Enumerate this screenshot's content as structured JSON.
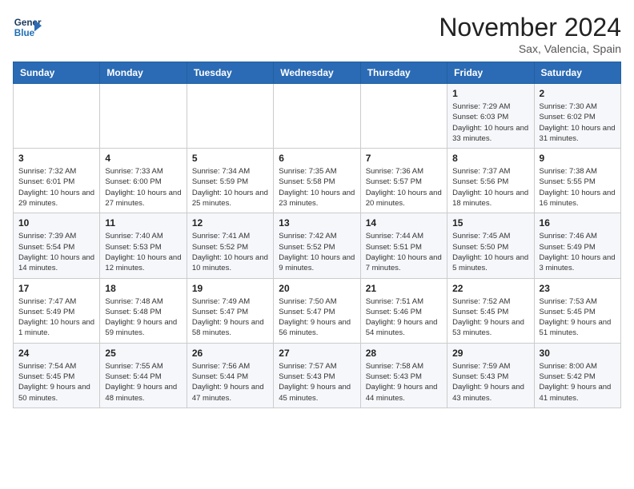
{
  "header": {
    "logo_line1": "General",
    "logo_line2": "Blue",
    "month": "November 2024",
    "location": "Sax, Valencia, Spain"
  },
  "weekdays": [
    "Sunday",
    "Monday",
    "Tuesday",
    "Wednesday",
    "Thursday",
    "Friday",
    "Saturday"
  ],
  "weeks": [
    [
      {
        "day": "",
        "info": ""
      },
      {
        "day": "",
        "info": ""
      },
      {
        "day": "",
        "info": ""
      },
      {
        "day": "",
        "info": ""
      },
      {
        "day": "",
        "info": ""
      },
      {
        "day": "1",
        "info": "Sunrise: 7:29 AM\nSunset: 6:03 PM\nDaylight: 10 hours\nand 33 minutes."
      },
      {
        "day": "2",
        "info": "Sunrise: 7:30 AM\nSunset: 6:02 PM\nDaylight: 10 hours\nand 31 minutes."
      }
    ],
    [
      {
        "day": "3",
        "info": "Sunrise: 7:32 AM\nSunset: 6:01 PM\nDaylight: 10 hours\nand 29 minutes."
      },
      {
        "day": "4",
        "info": "Sunrise: 7:33 AM\nSunset: 6:00 PM\nDaylight: 10 hours\nand 27 minutes."
      },
      {
        "day": "5",
        "info": "Sunrise: 7:34 AM\nSunset: 5:59 PM\nDaylight: 10 hours\nand 25 minutes."
      },
      {
        "day": "6",
        "info": "Sunrise: 7:35 AM\nSunset: 5:58 PM\nDaylight: 10 hours\nand 23 minutes."
      },
      {
        "day": "7",
        "info": "Sunrise: 7:36 AM\nSunset: 5:57 PM\nDaylight: 10 hours\nand 20 minutes."
      },
      {
        "day": "8",
        "info": "Sunrise: 7:37 AM\nSunset: 5:56 PM\nDaylight: 10 hours\nand 18 minutes."
      },
      {
        "day": "9",
        "info": "Sunrise: 7:38 AM\nSunset: 5:55 PM\nDaylight: 10 hours\nand 16 minutes."
      }
    ],
    [
      {
        "day": "10",
        "info": "Sunrise: 7:39 AM\nSunset: 5:54 PM\nDaylight: 10 hours\nand 14 minutes."
      },
      {
        "day": "11",
        "info": "Sunrise: 7:40 AM\nSunset: 5:53 PM\nDaylight: 10 hours\nand 12 minutes."
      },
      {
        "day": "12",
        "info": "Sunrise: 7:41 AM\nSunset: 5:52 PM\nDaylight: 10 hours\nand 10 minutes."
      },
      {
        "day": "13",
        "info": "Sunrise: 7:42 AM\nSunset: 5:52 PM\nDaylight: 10 hours\nand 9 minutes."
      },
      {
        "day": "14",
        "info": "Sunrise: 7:44 AM\nSunset: 5:51 PM\nDaylight: 10 hours\nand 7 minutes."
      },
      {
        "day": "15",
        "info": "Sunrise: 7:45 AM\nSunset: 5:50 PM\nDaylight: 10 hours\nand 5 minutes."
      },
      {
        "day": "16",
        "info": "Sunrise: 7:46 AM\nSunset: 5:49 PM\nDaylight: 10 hours\nand 3 minutes."
      }
    ],
    [
      {
        "day": "17",
        "info": "Sunrise: 7:47 AM\nSunset: 5:49 PM\nDaylight: 10 hours\nand 1 minute."
      },
      {
        "day": "18",
        "info": "Sunrise: 7:48 AM\nSunset: 5:48 PM\nDaylight: 9 hours\nand 59 minutes."
      },
      {
        "day": "19",
        "info": "Sunrise: 7:49 AM\nSunset: 5:47 PM\nDaylight: 9 hours\nand 58 minutes."
      },
      {
        "day": "20",
        "info": "Sunrise: 7:50 AM\nSunset: 5:47 PM\nDaylight: 9 hours\nand 56 minutes."
      },
      {
        "day": "21",
        "info": "Sunrise: 7:51 AM\nSunset: 5:46 PM\nDaylight: 9 hours\nand 54 minutes."
      },
      {
        "day": "22",
        "info": "Sunrise: 7:52 AM\nSunset: 5:45 PM\nDaylight: 9 hours\nand 53 minutes."
      },
      {
        "day": "23",
        "info": "Sunrise: 7:53 AM\nSunset: 5:45 PM\nDaylight: 9 hours\nand 51 minutes."
      }
    ],
    [
      {
        "day": "24",
        "info": "Sunrise: 7:54 AM\nSunset: 5:45 PM\nDaylight: 9 hours\nand 50 minutes."
      },
      {
        "day": "25",
        "info": "Sunrise: 7:55 AM\nSunset: 5:44 PM\nDaylight: 9 hours\nand 48 minutes."
      },
      {
        "day": "26",
        "info": "Sunrise: 7:56 AM\nSunset: 5:44 PM\nDaylight: 9 hours\nand 47 minutes."
      },
      {
        "day": "27",
        "info": "Sunrise: 7:57 AM\nSunset: 5:43 PM\nDaylight: 9 hours\nand 45 minutes."
      },
      {
        "day": "28",
        "info": "Sunrise: 7:58 AM\nSunset: 5:43 PM\nDaylight: 9 hours\nand 44 minutes."
      },
      {
        "day": "29",
        "info": "Sunrise: 7:59 AM\nSunset: 5:43 PM\nDaylight: 9 hours\nand 43 minutes."
      },
      {
        "day": "30",
        "info": "Sunrise: 8:00 AM\nSunset: 5:42 PM\nDaylight: 9 hours\nand 41 minutes."
      }
    ]
  ]
}
